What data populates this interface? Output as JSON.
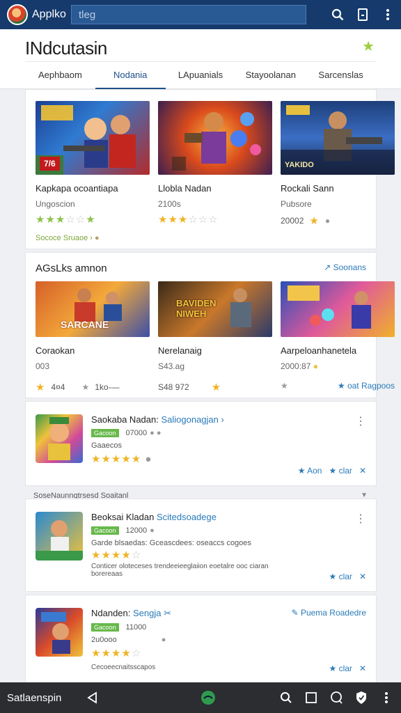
{
  "app": {
    "name": "Applko",
    "search_value": "tleg"
  },
  "header": {
    "title": "INdcutasin"
  },
  "tabs": [
    {
      "label": "Aephbaom",
      "active": false
    },
    {
      "label": "Nodania",
      "active": true
    },
    {
      "label": "LApuanials",
      "active": false
    },
    {
      "label": "Stayoolanan",
      "active": false
    },
    {
      "label": "Sarcenslas",
      "active": false
    }
  ],
  "featured": [
    {
      "title": "Kapkapa ocoantiapa",
      "sub": "Ungoscion",
      "chip": "Sococe Sruaoe ›",
      "rating": 3,
      "badge": "7/6"
    },
    {
      "title": "Llobla Nadan",
      "sub": "2100s",
      "rating": 2.5
    },
    {
      "title": "Rockali Sann",
      "sub": "Pubsore",
      "meta": "20002",
      "rating": 1,
      "thumb_text": "YAKIDO"
    }
  ],
  "section2": {
    "title": "AGsLks amnon",
    "link": "Soonans",
    "items": [
      {
        "title": "Coraokan",
        "sub": "003",
        "meta1": "4¤4",
        "meta2": "1ko-—",
        "thumb_text": "SARCANE"
      },
      {
        "title": "Nerelanaig",
        "sub": "S43.ag",
        "meta1": "S48 972",
        "thumb_text": "BAVIDEN NIWEH"
      },
      {
        "title": "Aarpeloanhanetela",
        "sub": "2000:87",
        "meta1": "oat Ragpoos"
      }
    ]
  },
  "list": [
    {
      "title": "Saokaba Nadan:",
      "dev": "Saliogonagjan",
      "badge": "Gacoon",
      "line1": "07000",
      "line2": "Gaaecos",
      "rating": 5,
      "actions": [
        "Aon",
        "clar"
      ]
    },
    {
      "title": "Beoksai Kladan",
      "dev": "Scitedsoadege",
      "badge": "Gacoon",
      "line1": "12000",
      "line2": "Garde blsaedas: Gceascdees: oseaccs cogoes",
      "rating": 4.5,
      "desc": "Conticer oloteceses trendeeieeglaiion eoetalre ooc ciaran borereaas",
      "actions": [
        "clar"
      ]
    },
    {
      "title": "Ndanden:",
      "dev": "Sengja",
      "link": "Puema Roadedre",
      "badge": "Gacoon",
      "line1": "11000",
      "line2": "2u0ooo",
      "rating": 4.5,
      "desc": "Cecoeecnaitsscapos",
      "actions": [
        "clar"
      ]
    }
  ],
  "divider": {
    "label": "SoseNaunngtrsesd Soaitanl"
  },
  "bottombar": {
    "label": "Satlaenspin"
  },
  "colors": {
    "topbar": "#153a6b",
    "accent": "#2a7ab8",
    "star": "#f0b324",
    "green": "#8bc34a"
  }
}
